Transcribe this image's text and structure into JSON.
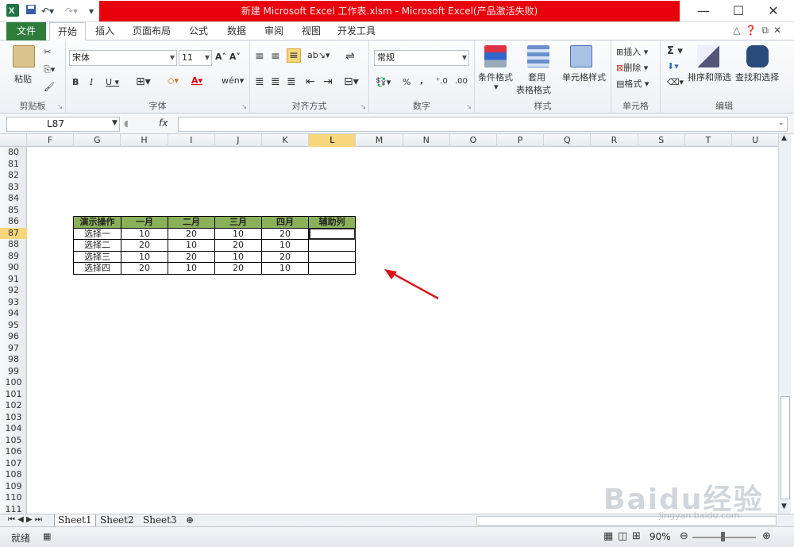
{
  "title_bar": {
    "title": "新建 Microsoft Excel 工作表.xlsm - Microsoft Excel(产品激活失败)"
  },
  "tabs": {
    "file": "文件",
    "items": [
      "开始",
      "插入",
      "页面布局",
      "公式",
      "数据",
      "审阅",
      "视图",
      "开发工具"
    ]
  },
  "ribbon": {
    "clipboard": {
      "paste": "粘贴",
      "label": "剪贴板"
    },
    "font": {
      "name": "宋体",
      "size": "11",
      "label": "字体"
    },
    "alignment": {
      "label": "对齐方式"
    },
    "number": {
      "format": "常规",
      "percent": "%",
      "comma": ",",
      "label": "数字"
    },
    "styles": {
      "conditional": "条件格式",
      "table1": "套用",
      "table2": "表格格式",
      "cell_style": "单元格样式",
      "label": "样式"
    },
    "cells": {
      "insert": "插入",
      "delete": "删除",
      "format": "格式",
      "label": "单元格"
    },
    "editing": {
      "sum": "Σ",
      "sort": "排序和筛选",
      "find": "查找和选择",
      "label": "编辑"
    }
  },
  "formula_bar": {
    "name_box": "L87",
    "fx": "fx"
  },
  "columns": [
    "F",
    "G",
    "H",
    "I",
    "J",
    "K",
    "L",
    "M",
    "N",
    "O",
    "P",
    "Q",
    "R",
    "S",
    "T",
    "U"
  ],
  "rows": [
    "80",
    "81",
    "82",
    "83",
    "84",
    "85",
    "86",
    "87",
    "88",
    "89",
    "90",
    "91",
    "92",
    "93",
    "94",
    "95",
    "96",
    "97",
    "98",
    "99",
    "100",
    "101",
    "102",
    "103",
    "104",
    "105",
    "106",
    "107",
    "108",
    "109",
    "110",
    "111"
  ],
  "table": {
    "headers": [
      "演示操作",
      "一月",
      "二月",
      "三月",
      "四月",
      "辅助列"
    ],
    "rows": [
      [
        "选择一",
        "10",
        "20",
        "10",
        "20",
        ""
      ],
      [
        "选择二",
        "20",
        "10",
        "20",
        "10",
        ""
      ],
      [
        "选择三",
        "10",
        "20",
        "10",
        "20",
        ""
      ],
      [
        "选择四",
        "20",
        "10",
        "20",
        "10",
        ""
      ]
    ]
  },
  "sheets": [
    "Sheet1",
    "Sheet2",
    "Sheet3"
  ],
  "status": {
    "ready": "就绪",
    "zoom": "90%"
  },
  "watermark": {
    "logo": "Baidu经验",
    "url": "jingyan.baidu.com"
  },
  "colors": {
    "file_tab": "#2f7d3b",
    "title_bar": "#e8000a",
    "table_header": "#8ab15a",
    "selection": "#f7d67c",
    "arrow": "#d9141c"
  }
}
